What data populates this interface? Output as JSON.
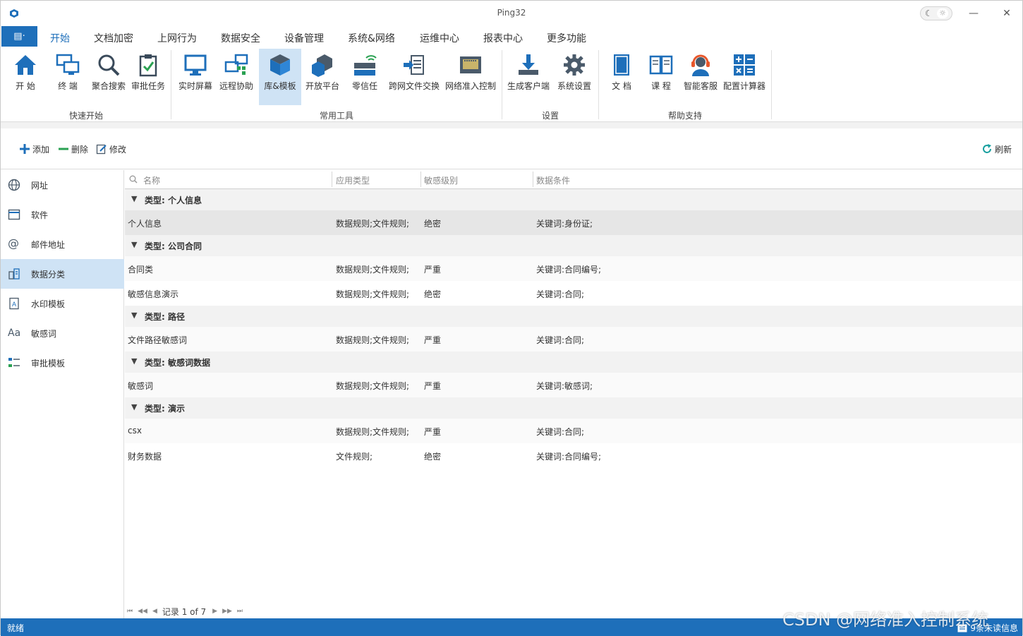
{
  "window": {
    "title": "Ping32",
    "minimize": "—",
    "maximize": "☐",
    "close": "✕"
  },
  "menu": {
    "file_glyph": "▤·",
    "tabs": [
      "开始",
      "文档加密",
      "上网行为",
      "数据安全",
      "设备管理",
      "系统&网络",
      "运维中心",
      "报表中心",
      "更多功能"
    ]
  },
  "ribbon": {
    "groups": [
      {
        "label": "快速开始",
        "items": [
          "开 始",
          "终 端",
          "聚合搜索",
          "审批任务"
        ]
      },
      {
        "label": "常用工具",
        "items": [
          "实时屏幕",
          "远程协助",
          "库&模板",
          "开放平台",
          "零信任",
          "跨网文件交换",
          "网络准入控制"
        ]
      },
      {
        "label": "设置",
        "items": [
          "生成客户端",
          "系统设置"
        ]
      },
      {
        "label": "帮助支持",
        "items": [
          "文 档",
          "课 程",
          "智能客服",
          "配置计算器"
        ]
      }
    ],
    "selected_item": "库&模板"
  },
  "toolbar": {
    "add": "添加",
    "delete": "删除",
    "edit": "修改",
    "refresh": "刷新"
  },
  "nav": {
    "items": [
      "网址",
      "软件",
      "邮件地址",
      "数据分类",
      "水印模板",
      "敏感词",
      "审批模板"
    ],
    "active": "数据分类"
  },
  "grid": {
    "columns": [
      "名称",
      "应用类型",
      "敏感级别",
      "数据条件"
    ],
    "groups": [
      {
        "label": "类型: 个人信息",
        "rows": [
          {
            "name": "个人信息",
            "app_type": "数据规则;文件规则;",
            "level": "绝密",
            "condition": "关键词:身份证;"
          }
        ]
      },
      {
        "label": "类型: 公司合同",
        "rows": [
          {
            "name": "合同类",
            "app_type": "数据规则;文件规则;",
            "level": "严重",
            "condition": "关键词:合同编号;"
          },
          {
            "name": "敏感信息演示",
            "app_type": "数据规则;文件规则;",
            "level": "绝密",
            "condition": "关键词:合同;"
          }
        ]
      },
      {
        "label": "类型: 路径",
        "rows": [
          {
            "name": "文件路径敏感词",
            "app_type": "数据规则;文件规则;",
            "level": "严重",
            "condition": "关键词:合同;"
          }
        ]
      },
      {
        "label": "类型: 敏感词数据",
        "rows": [
          {
            "name": "敏感词",
            "app_type": "数据规则;文件规则;",
            "level": "严重",
            "condition": "关键词:敏感词;"
          }
        ]
      },
      {
        "label": "类型: 演示",
        "rows": [
          {
            "name": "csx",
            "app_type": "数据规则;文件规则;",
            "level": "严重",
            "condition": "关键词:合同;"
          },
          {
            "name": "财务数据",
            "app_type": "文件规则;",
            "level": "绝密",
            "condition": "关键词:合同编号;"
          }
        ]
      }
    ],
    "pager": "记录 1 of 7"
  },
  "status": {
    "text": "就绪",
    "unread": "9条未读信息"
  },
  "watermark": "CSDN @网络准入控制系统",
  "colors": {
    "accent": "#1e6fba",
    "selection": "#cfe3f5"
  }
}
